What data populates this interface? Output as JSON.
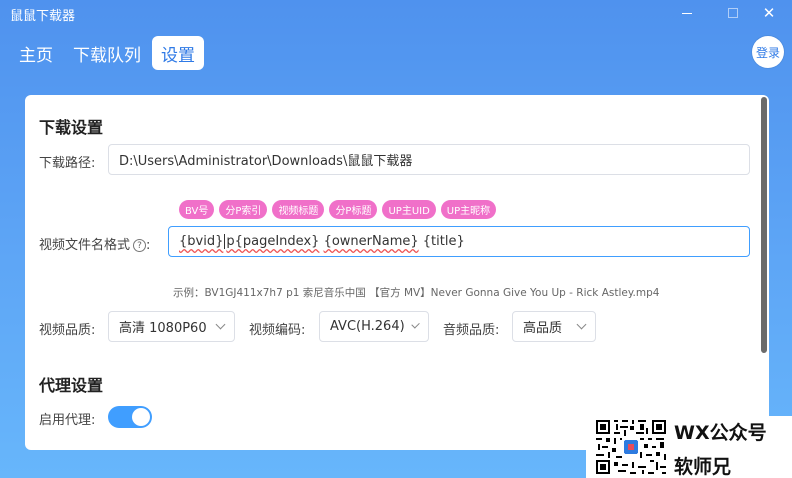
{
  "window": {
    "title": "鼠鼠下载器"
  },
  "nav": {
    "tabs": [
      {
        "label": "主页"
      },
      {
        "label": "下载队列"
      },
      {
        "label": "设置"
      }
    ],
    "active": "设置"
  },
  "login": {
    "label": "登录"
  },
  "download": {
    "section_title": "下载设置",
    "path_label": "下载路径:",
    "path_value": "D:\\Users\\Administrator\\Downloads\\鼠鼠下载器",
    "tags": [
      "BV号",
      "分P索引",
      "视频标题",
      "分P标题",
      "UP主UID",
      "UP主昵称"
    ],
    "filename_label": "视频文件名格式",
    "filename_help": "?",
    "filename_colon": ":",
    "filename_parts": [
      "{bvid}",
      "p{pageIndex}",
      "{ownerName}",
      "{title}"
    ],
    "example": "示例：BV1GJ411x7h7 p1 索尼音乐中国 【官方 MV】Never Gonna Give You Up - Rick Astley.mp4",
    "quality_label": "视频品质:",
    "quality_value": "高清 1080P60",
    "codec_label": "视频编码:",
    "codec_value": "AVC(H.264)",
    "audio_label": "音频品质:",
    "audio_value": "高品质"
  },
  "proxy": {
    "section_title": "代理设置",
    "enable_label": "启用代理:",
    "enabled": true
  },
  "watermark": {
    "line1": "WX公众号",
    "line2": "软师兄"
  },
  "colors": {
    "accent": "#409eff",
    "tag": "#f070c9",
    "background": "#5ea6f6"
  }
}
